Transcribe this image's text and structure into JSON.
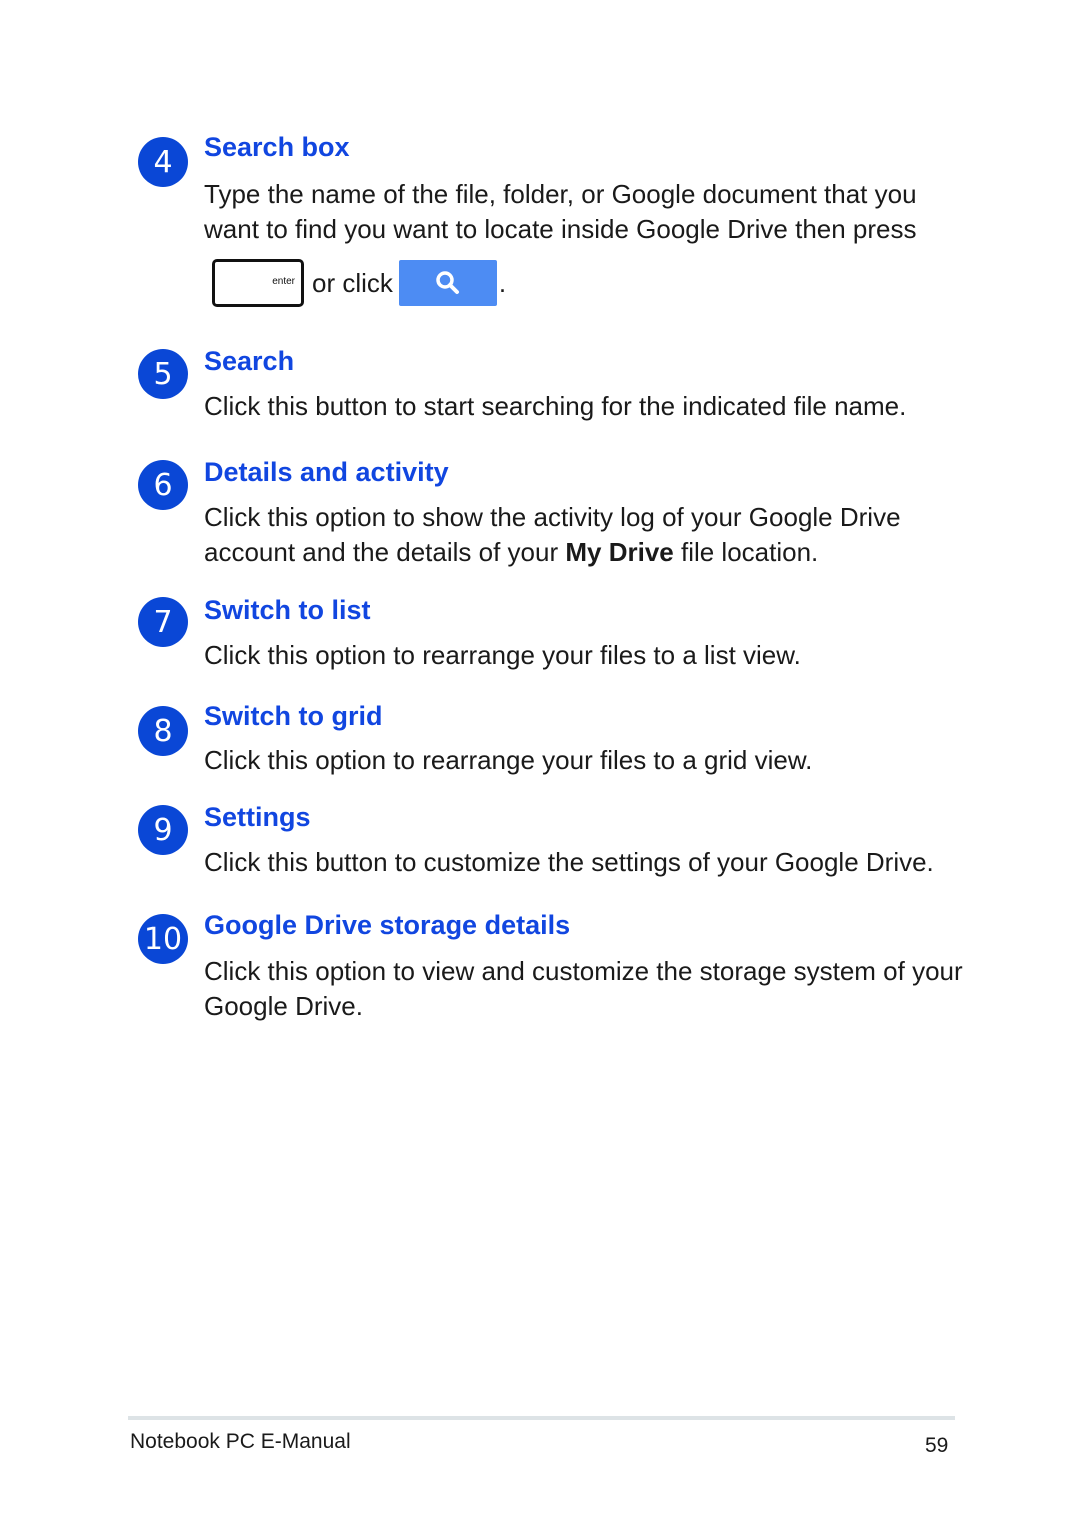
{
  "items": [
    {
      "number": "4",
      "title": "Search box",
      "desc_lines": [
        "Type the name of the file, folder, or Google document that you",
        "want to find you want to locate inside Google Drive then press"
      ]
    },
    {
      "number": "5",
      "title": "Search",
      "desc": "Click this button to start searching for the indicated file name."
    },
    {
      "number": "6",
      "title": "Details and activity",
      "desc_pre": "Click this option to show the activity log of your Google Drive account and the details of your ",
      "desc_bold": "My Drive",
      "desc_post": " file location."
    },
    {
      "number": "7",
      "title": "Switch to list",
      "desc": "Click this option to rearrange your files to a list view."
    },
    {
      "number": "8",
      "title": "Switch to grid",
      "desc": "Click this option to rearrange your files to a grid view."
    },
    {
      "number": "9",
      "title": "Settings",
      "desc": "Click this button to customize the settings of your Google Drive."
    },
    {
      "number": "10",
      "title": "Google Drive storage details",
      "desc": "Click this option to view and customize the storage system of your Google Drive."
    }
  ],
  "keyrow": {
    "enter_label": "enter",
    "or_click": "or click",
    "period": ".",
    "search_icon": "magnifier-icon"
  },
  "footer": {
    "title": "Notebook PC E-Manual",
    "page": "59"
  },
  "colors": {
    "accent": "#1146e0",
    "badge": "#0a47d6",
    "search_button": "#4d8cf3"
  }
}
